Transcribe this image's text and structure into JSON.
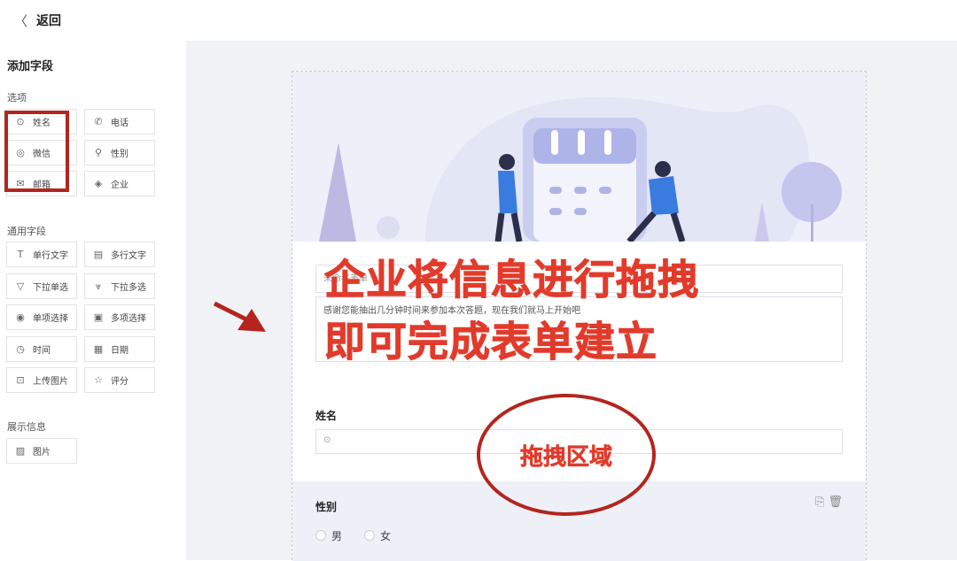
{
  "topbar": {
    "back_icon": "chevron-left-icon",
    "back_label": "返回"
  },
  "sidebar": {
    "title": "添加字段",
    "sections": [
      {
        "label": "选项",
        "fields": [
          {
            "label": "姓名",
            "icon": "user-circle-icon"
          },
          {
            "label": "电话",
            "icon": "phone-icon"
          },
          {
            "label": "微信",
            "icon": "wechat-icon"
          },
          {
            "label": "性别",
            "icon": "gender-icon"
          },
          {
            "label": "邮箱",
            "icon": "mail-icon"
          },
          {
            "label": "企业",
            "icon": "company-icon"
          }
        ]
      },
      {
        "label": "通用字段",
        "fields": [
          {
            "label": "单行文字",
            "icon": "text-icon"
          },
          {
            "label": "多行文字",
            "icon": "multiline-icon"
          },
          {
            "label": "下拉单选",
            "icon": "dropdown-icon"
          },
          {
            "label": "下拉多选",
            "icon": "dropdown-multi-icon"
          },
          {
            "label": "单项选择",
            "icon": "radio-icon"
          },
          {
            "label": "多项选择",
            "icon": "checkbox-icon"
          },
          {
            "label": "时间",
            "icon": "clock-icon"
          },
          {
            "label": "日期",
            "icon": "calendar-icon"
          },
          {
            "label": "上传图片",
            "icon": "upload-image-icon"
          },
          {
            "label": "评分",
            "icon": "star-icon"
          }
        ]
      },
      {
        "label": "展示信息",
        "fields": [
          {
            "label": "图片",
            "icon": "image-icon"
          }
        ]
      }
    ]
  },
  "form": {
    "title_placeholder": "未命名表单",
    "description": "感谢您能抽出几分钟时间来参加本次答题，现在我们就马上开始吧",
    "name_label": "姓名",
    "gender_label": "性别",
    "gender_options": [
      "男",
      "女"
    ]
  },
  "annotations": {
    "line1": "企业将信息进行拖拽",
    "line2": "即可完成表单建立",
    "drag_zone": "拖拽区域"
  },
  "colors": {
    "accent_red": "#e23b2b",
    "box_red": "#b3251e",
    "canvas_bg": "#f1f2f5"
  }
}
